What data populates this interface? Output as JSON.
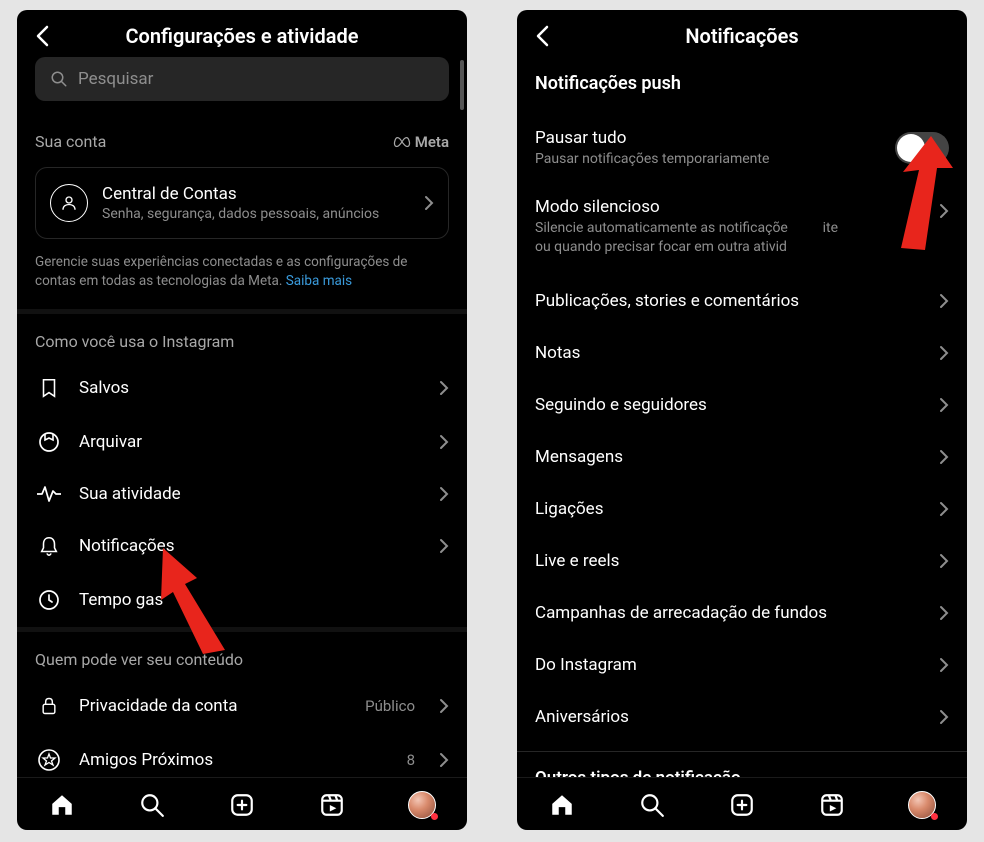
{
  "screen1": {
    "title": "Configurações e atividade",
    "search_placeholder": "Pesquisar",
    "account": {
      "section_label": "Sua conta",
      "brand_text": "Meta",
      "card_title": "Central de Contas",
      "card_subtitle": "Senha, segurança, dados pessoais, anúncios",
      "info_text": "Gerencie suas experiências conectadas e as configurações de contas em todas as tecnologias da Meta. ",
      "info_link": "Saiba mais"
    },
    "usage": {
      "section_label": "Como você usa o Instagram",
      "items": [
        {
          "icon": "bookmark",
          "label": "Salvos"
        },
        {
          "icon": "archive",
          "label": "Arquivar"
        },
        {
          "icon": "activity",
          "label": "Sua atividade"
        },
        {
          "icon": "bell",
          "label": "Notificações"
        },
        {
          "icon": "clock",
          "label": "Tempo gas"
        }
      ]
    },
    "visibility": {
      "section_label": "Quem pode ver seu conteúdo",
      "items": [
        {
          "icon": "lock",
          "label": "Privacidade da conta",
          "value": "Público"
        },
        {
          "icon": "star",
          "label": "Amigos Próximos",
          "value": "8"
        }
      ]
    }
  },
  "screen2": {
    "title": "Notificações",
    "push_section": "Notificações push",
    "pause": {
      "title": "Pausar tudo",
      "subtitle": "Pausar notificações temporariamente"
    },
    "silent": {
      "title": "Modo silencioso",
      "subtitle_a": "Silencie automaticamente as notificaçõe",
      "subtitle_b": "ite",
      "subtitle_c": "ou quando precisar focar em outra ativid"
    },
    "items": [
      "Publicações, stories e comentários",
      "Notas",
      "Seguindo e seguidores",
      "Mensagens",
      "Ligações",
      "Live e reels",
      "Campanhas de arrecadação de fundos",
      "Do Instagram",
      "Aniversários"
    ],
    "other_section": "Outros tipos de notificação"
  }
}
